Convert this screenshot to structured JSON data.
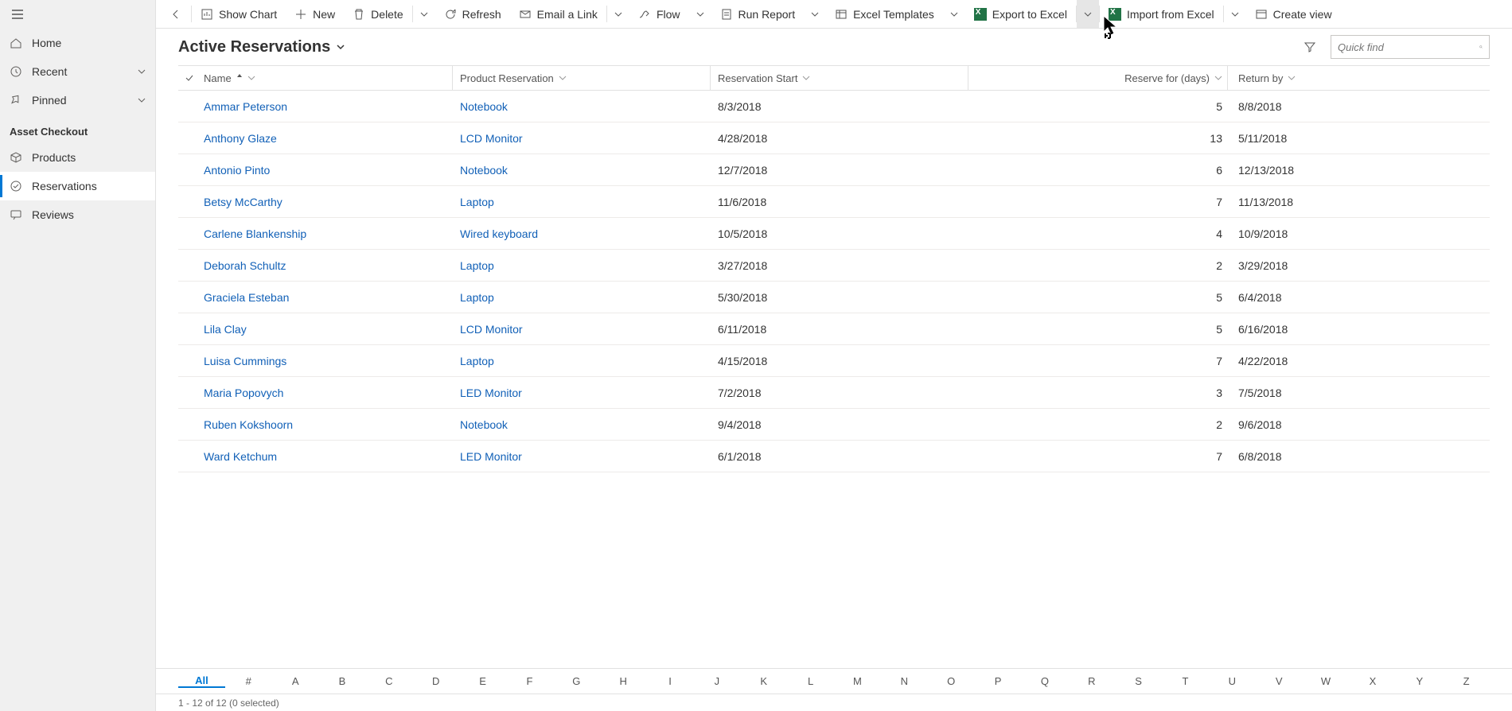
{
  "sidebar": {
    "nav": [
      {
        "id": "home",
        "label": "Home"
      },
      {
        "id": "recent",
        "label": "Recent",
        "expandable": true
      },
      {
        "id": "pinned",
        "label": "Pinned",
        "expandable": true
      }
    ],
    "section_title": "Asset Checkout",
    "section_items": [
      {
        "id": "products",
        "label": "Products"
      },
      {
        "id": "reservations",
        "label": "Reservations",
        "active": true
      },
      {
        "id": "reviews",
        "label": "Reviews"
      }
    ]
  },
  "toolbar": {
    "show_chart": "Show Chart",
    "new": "New",
    "delete": "Delete",
    "refresh": "Refresh",
    "email_link": "Email a Link",
    "flow": "Flow",
    "run_report": "Run Report",
    "excel_templates": "Excel Templates",
    "export_excel": "Export to Excel",
    "import_excel": "Import from Excel",
    "create_view": "Create view"
  },
  "view": {
    "title": "Active Reservations",
    "quick_find_placeholder": "Quick find"
  },
  "grid": {
    "headers": {
      "name": "Name",
      "product": "Product Reservation",
      "start": "Reservation Start",
      "days": "Reserve for (days)",
      "return": "Return by"
    },
    "rows": [
      {
        "name": "Ammar Peterson",
        "product": "Notebook",
        "start": "8/3/2018",
        "days": "5",
        "return": "8/8/2018"
      },
      {
        "name": "Anthony Glaze",
        "product": "LCD Monitor",
        "start": "4/28/2018",
        "days": "13",
        "return": "5/11/2018"
      },
      {
        "name": "Antonio Pinto",
        "product": "Notebook",
        "start": "12/7/2018",
        "days": "6",
        "return": "12/13/2018"
      },
      {
        "name": "Betsy McCarthy",
        "product": "Laptop",
        "start": "11/6/2018",
        "days": "7",
        "return": "11/13/2018"
      },
      {
        "name": "Carlene Blankenship",
        "product": "Wired keyboard",
        "start": "10/5/2018",
        "days": "4",
        "return": "10/9/2018"
      },
      {
        "name": "Deborah Schultz",
        "product": "Laptop",
        "start": "3/27/2018",
        "days": "2",
        "return": "3/29/2018"
      },
      {
        "name": "Graciela Esteban",
        "product": "Laptop",
        "start": "5/30/2018",
        "days": "5",
        "return": "6/4/2018"
      },
      {
        "name": "Lila Clay",
        "product": "LCD Monitor",
        "start": "6/11/2018",
        "days": "5",
        "return": "6/16/2018"
      },
      {
        "name": "Luisa Cummings",
        "product": "Laptop",
        "start": "4/15/2018",
        "days": "7",
        "return": "4/22/2018"
      },
      {
        "name": "Maria Popovych",
        "product": "LED Monitor",
        "start": "7/2/2018",
        "days": "3",
        "return": "7/5/2018"
      },
      {
        "name": "Ruben Kokshoorn",
        "product": "Notebook",
        "start": "9/4/2018",
        "days": "2",
        "return": "9/6/2018"
      },
      {
        "name": "Ward Ketchum",
        "product": "LED Monitor",
        "start": "6/1/2018",
        "days": "7",
        "return": "6/8/2018"
      }
    ]
  },
  "alpha": [
    "All",
    "#",
    "A",
    "B",
    "C",
    "D",
    "E",
    "F",
    "G",
    "H",
    "I",
    "J",
    "K",
    "L",
    "M",
    "N",
    "O",
    "P",
    "Q",
    "R",
    "S",
    "T",
    "U",
    "V",
    "W",
    "X",
    "Y",
    "Z"
  ],
  "status": "1 - 12 of 12 (0 selected)"
}
